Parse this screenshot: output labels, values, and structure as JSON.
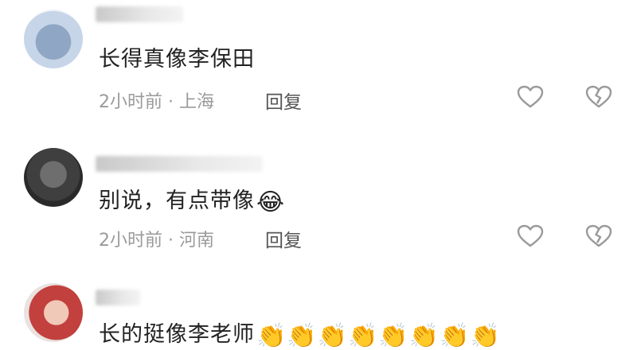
{
  "comments": [
    {
      "text": "长得真像李保田",
      "meta": "2小时前 · 上海",
      "reply_label": "回复",
      "emoji": ""
    },
    {
      "text": "别说，有点带像",
      "meta": "2小时前 · 河南",
      "reply_label": "回复",
      "emoji": "😂"
    },
    {
      "text": "长的挺像李老师",
      "emoji": "👏👏👏👏👏👏👏👏"
    }
  ],
  "icons": [
    "like-heart-icon",
    "dislike-broken-heart-icon"
  ],
  "colors": {
    "text": "#222222",
    "meta": "#9a9a9a",
    "icon": "#9a9a9a"
  }
}
